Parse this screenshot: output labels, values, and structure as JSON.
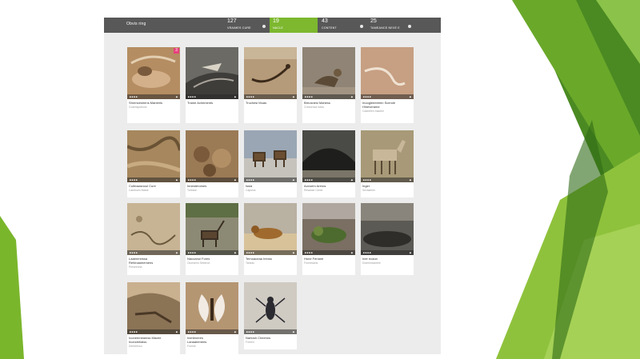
{
  "colors": {
    "accent": "#7db82f",
    "bar": "#585858",
    "badge": "#e8407e"
  },
  "header": {
    "title": "Obvis ring",
    "tabs": [
      {
        "num": "127",
        "label": "VRAIMES CURE",
        "icon": "circle-icon"
      },
      {
        "num": "19",
        "label": "NACLE",
        "active": true
      },
      {
        "num": "43",
        "label": "CONTENT",
        "icon": "circle-icon"
      },
      {
        "num": "25",
        "label": "TAMEANCE NEVE E",
        "icon": "circle-icon"
      }
    ]
  },
  "cards": [
    {
      "caption": "Shrenceshens Manteris",
      "sub": "Cosenspotions",
      "flag": "3"
    },
    {
      "caption": "Trame Acimments",
      "sub": ""
    },
    {
      "caption": "Truchesi Muas",
      "sub": ""
    },
    {
      "caption": "Breosnesi Mahess",
      "sub": "Cressensa Isess"
    },
    {
      "caption": "Inoogleeeeeen Scerole",
      "caption2": "Hineverame",
      "sub": "Cadmeen Inaceer"
    },
    {
      "caption": "Cultivaasnoul Cure",
      "sub": "Cambuen Mawe"
    },
    {
      "caption": "Innesteromes",
      "sub": "Toresse"
    },
    {
      "caption": "Issia",
      "sub": "Capulos"
    },
    {
      "caption": "Aovoem Areros",
      "sub": "Resanse Ceme"
    },
    {
      "caption": "Inger",
      "sub": "Sevsamen"
    },
    {
      "caption": "Laabrennssa",
      "caption2": "Rehinaamemens",
      "sub": "Perseenna"
    },
    {
      "caption": "Nacoanui Fores",
      "sub": "Ocorsenn Seeenoi"
    },
    {
      "caption": "Ternoaceaa Irenss",
      "sub": "Taneas"
    },
    {
      "caption": "Hone Feriane",
      "sub": "Fornresans"
    },
    {
      "caption": "Iner ecaon",
      "sub": "Dommnssneee"
    },
    {
      "caption": "Iooneemeamss Macee",
      "caption2": "Inonceelaiss",
      "sub": "Dereeenso"
    },
    {
      "caption": "Inerieneres",
      "caption2": "Lanaairenees",
      "sub": "Forrine"
    },
    {
      "caption": "Nartosh Cheenns",
      "sub": "Foreen"
    }
  ]
}
